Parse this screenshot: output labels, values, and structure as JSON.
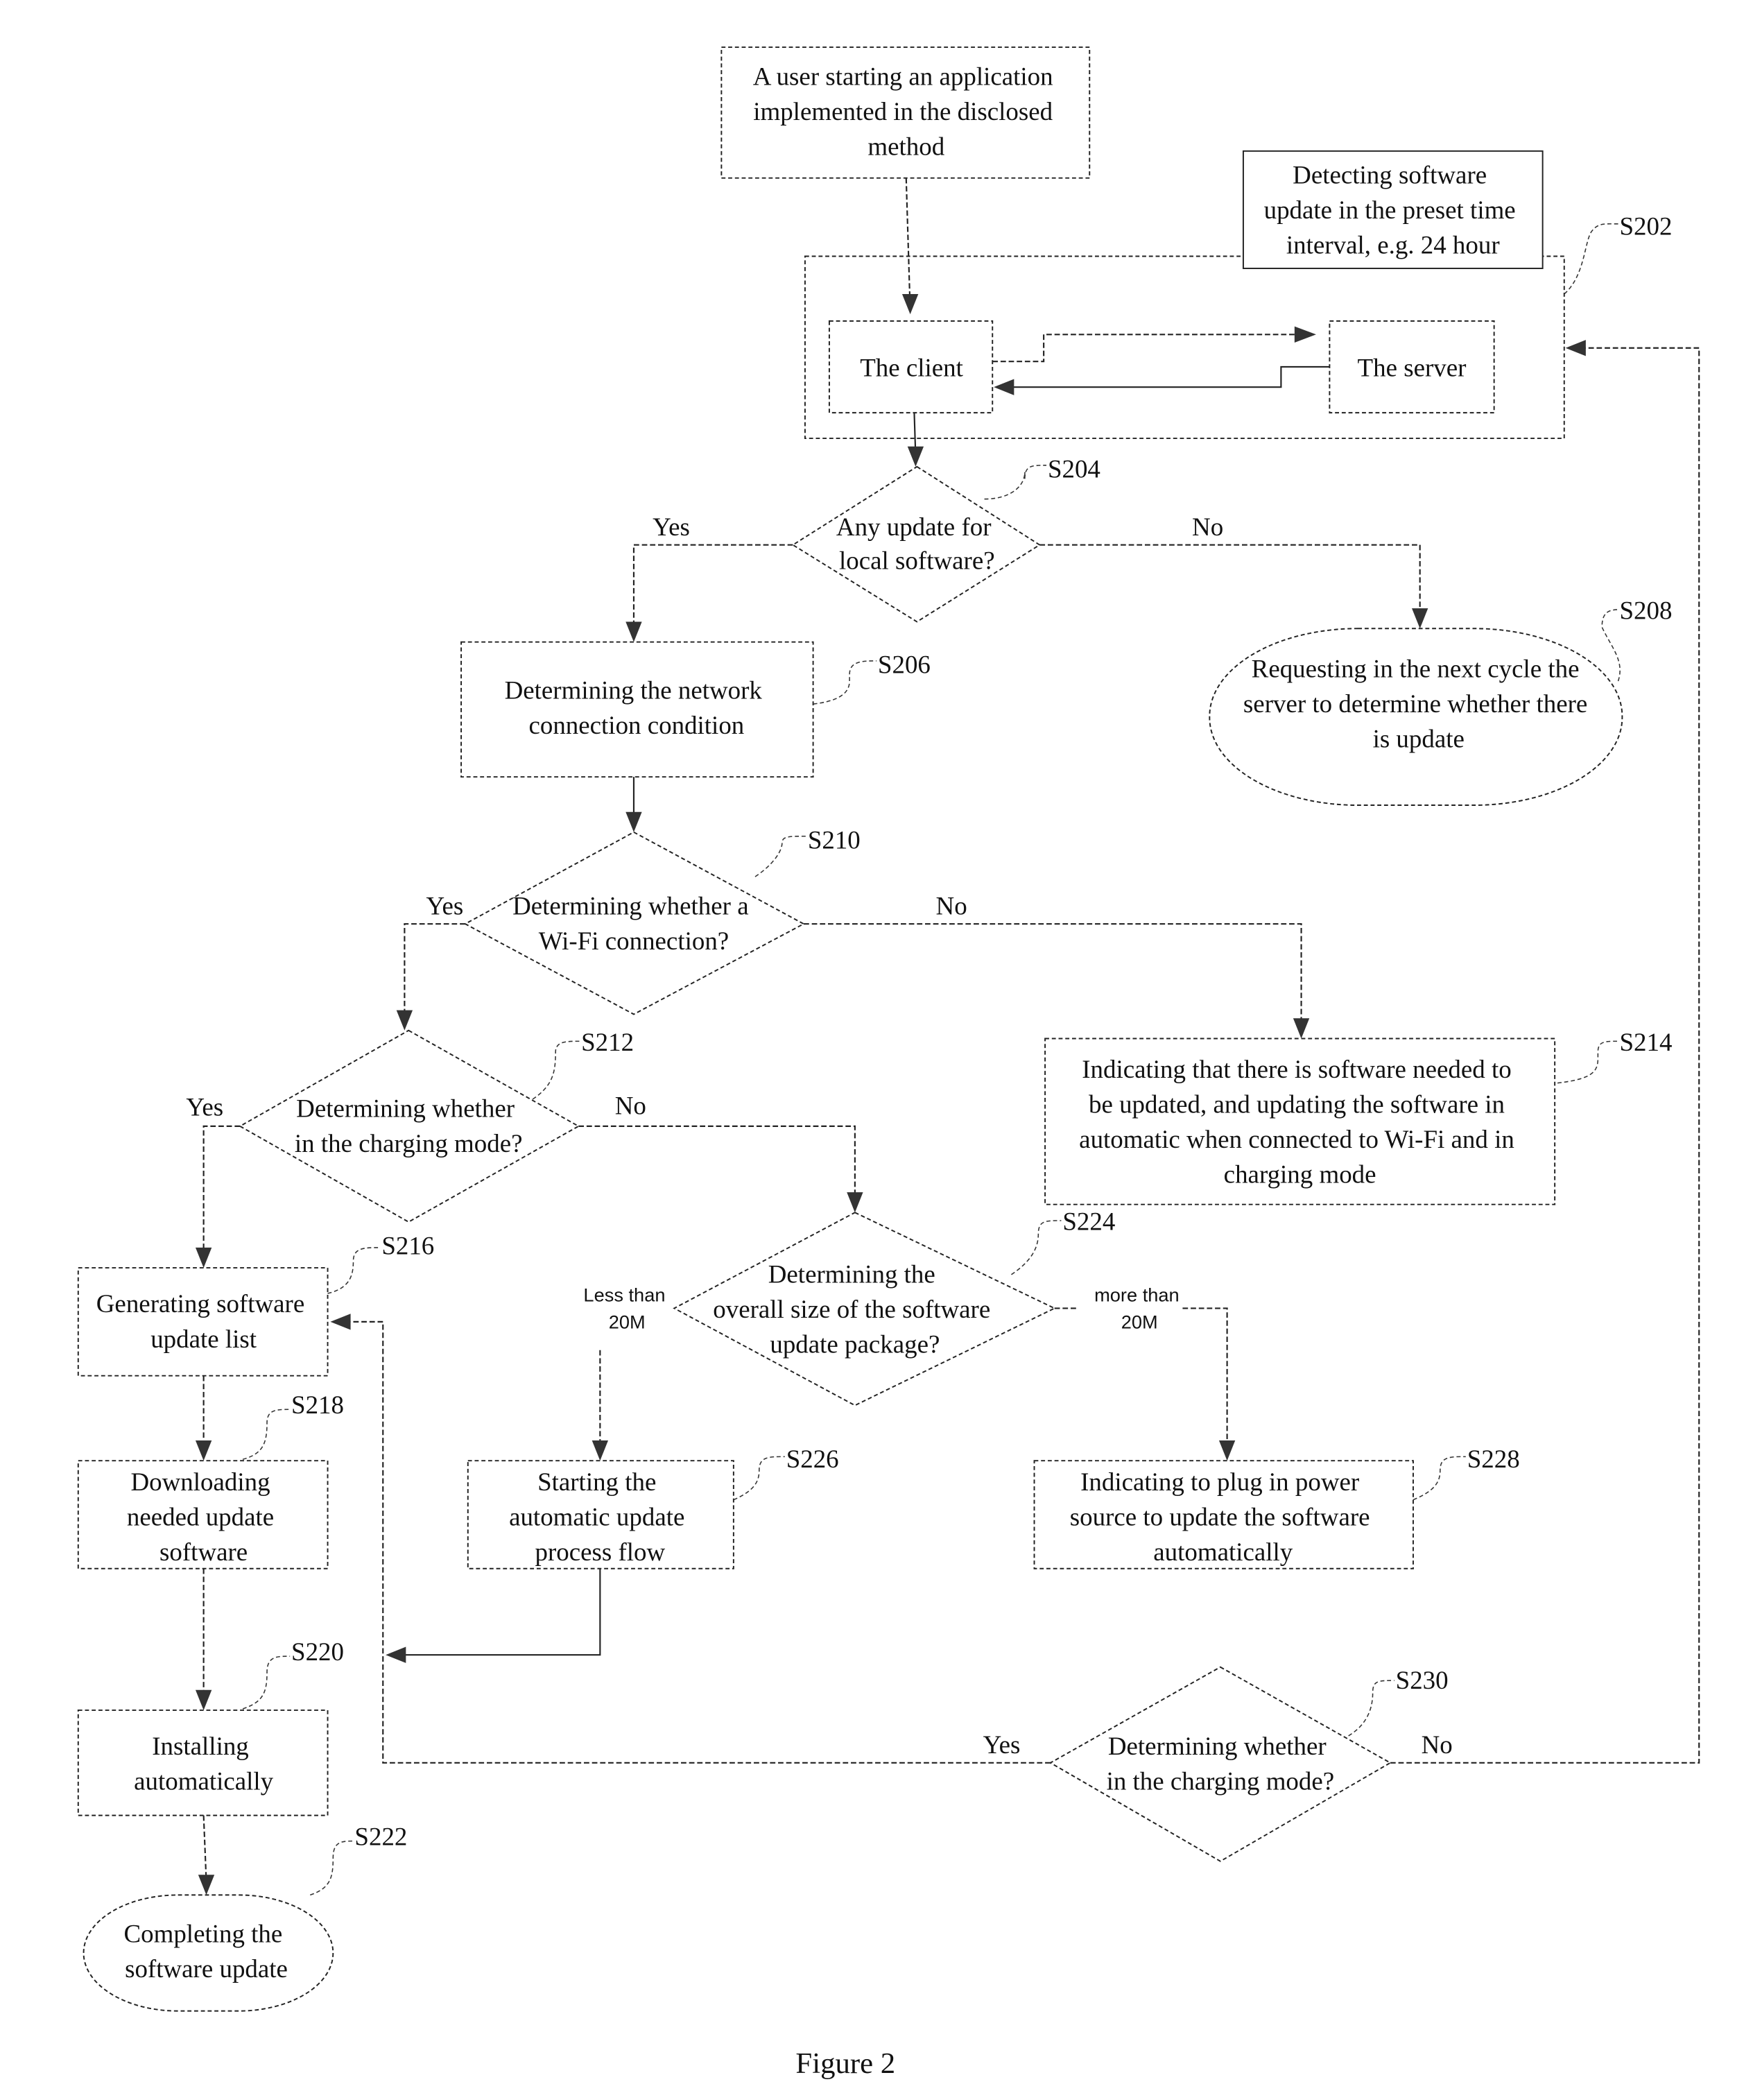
{
  "figure": {
    "caption": "Figure 2"
  },
  "nodes": {
    "start": {
      "lines": [
        "A user starting an application",
        "implemented in the disclosed",
        "method"
      ]
    },
    "note_interval": {
      "lines": [
        "Detecting software",
        "update in the preset time",
        "interval, e.g. 24 hour"
      ]
    },
    "client": {
      "lines": [
        "The client"
      ]
    },
    "server": {
      "lines": [
        "The server"
      ]
    },
    "s204": {
      "lines": [
        "Any update for",
        "local software?"
      ]
    },
    "s206": {
      "lines": [
        "Determining the network",
        "connection condition"
      ]
    },
    "s208": {
      "lines": [
        "Requesting in the next cycle the",
        "server to determine whether there",
        "is update"
      ]
    },
    "s210": {
      "lines": [
        "Determining whether a",
        "Wi-Fi connection?"
      ]
    },
    "s212": {
      "lines": [
        "Determining whether",
        "in the charging mode?"
      ]
    },
    "s214": {
      "lines": [
        "Indicating that there is software needed to",
        "be updated, and updating the software in",
        "automatic when connected to Wi-Fi and in",
        "charging mode"
      ]
    },
    "s216": {
      "lines": [
        "Generating software",
        "update list"
      ]
    },
    "s218": {
      "lines": [
        "Downloading",
        "needed update",
        "software"
      ]
    },
    "s220": {
      "lines": [
        "Installing",
        "automatically"
      ]
    },
    "s222": {
      "lines": [
        "Completing the",
        "software update"
      ]
    },
    "s224": {
      "lines": [
        "Determining the",
        "overall size of the software",
        "update package?"
      ]
    },
    "s226": {
      "lines": [
        "Starting the",
        "automatic update",
        "process flow"
      ]
    },
    "s228": {
      "lines": [
        "Indicating to plug in power",
        "source to update the software",
        "automatically"
      ]
    },
    "s230": {
      "lines": [
        "Determining whether",
        "in the charging mode?"
      ]
    }
  },
  "step_labels": {
    "s202": "S202",
    "s204": "S204",
    "s206": "S206",
    "s208": "S208",
    "s210": "S210",
    "s212": "S212",
    "s214": "S214",
    "s216": "S216",
    "s218": "S218",
    "s220": "S220",
    "s222": "S222",
    "s224": "S224",
    "s226": "S226",
    "s228": "S228",
    "s230": "S230"
  },
  "edge_labels": {
    "s204_yes": "Yes",
    "s204_no": "No",
    "s210_yes": "Yes",
    "s210_no": "No",
    "s212_yes": "Yes",
    "s212_no": "No",
    "s224_less": [
      "Less than",
      "20M"
    ],
    "s224_more": [
      "more than",
      "20M"
    ],
    "s230_yes": "Yes",
    "s230_no": "No"
  }
}
